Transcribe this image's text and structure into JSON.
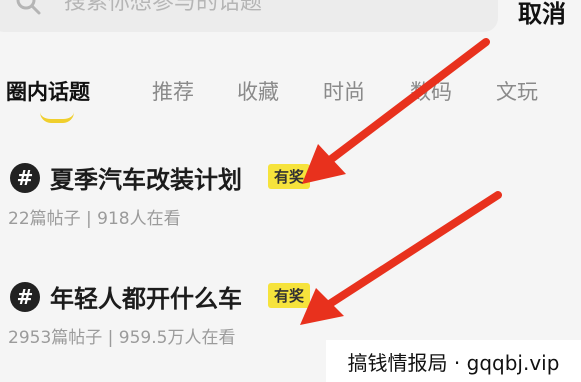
{
  "search": {
    "placeholder": "搜索你想参与的话题",
    "cancel_label": "取消"
  },
  "tabs": [
    {
      "label": "圈内话题",
      "active": true
    },
    {
      "label": "推荐",
      "active": false
    },
    {
      "label": "收藏",
      "active": false
    },
    {
      "label": "时尚",
      "active": false
    },
    {
      "label": "数码",
      "active": false
    },
    {
      "label": "文玩",
      "active": false
    }
  ],
  "topics": [
    {
      "icon": "#",
      "title": "夏季汽车改装计划",
      "badge": "有奖",
      "meta": "22篇帖子 | 918人在看"
    },
    {
      "icon": "#",
      "title": "年轻人都开什么车",
      "badge": "有奖",
      "meta": "2953篇帖子 | 959.5万人在看"
    }
  ],
  "watermark": {
    "text": "搞钱情报局 · gqqbj.vip"
  },
  "colors": {
    "accent": "#f0cf2d",
    "badge": "#f6e33c",
    "arrow": "#e8311d"
  }
}
